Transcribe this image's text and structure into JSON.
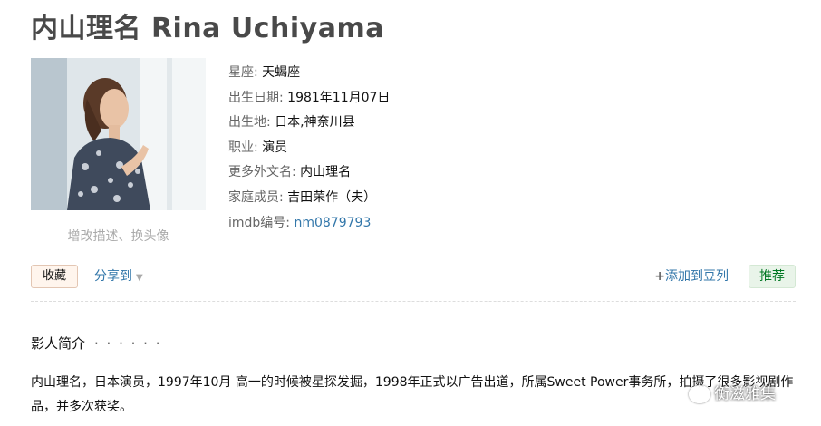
{
  "title": "内山理名 Rina Uchiyama",
  "photo": {
    "link_text": "增改描述、换头像"
  },
  "info": [
    {
      "label": "星座:",
      "value": "天蝎座"
    },
    {
      "label": "出生日期:",
      "value": "1981年11月07日"
    },
    {
      "label": "出生地:",
      "value": "日本,神奈川县"
    },
    {
      "label": "职业:",
      "value": "演员"
    },
    {
      "label": "更多外文名:",
      "value": "内山理名"
    },
    {
      "label": "家庭成员:",
      "value": "吉田荣作（夫）"
    },
    {
      "label": "imdb编号:",
      "value": "nm0879793"
    }
  ],
  "actions": {
    "fav": "收藏",
    "share": "分享到",
    "add_plus": "+",
    "add": "添加到豆列",
    "recommend": "推荐"
  },
  "intro": {
    "heading": "影人简介",
    "dots": "· · · · · ·",
    "text": "内山理名，日本演员，1997年10月 高一的时候被星探发掘，1998年正式以广告出道，所属Sweet Power事务所，拍摄了很多影视剧作品，并多次获奖。"
  },
  "watermark": "衡滋雅集",
  "colors": {
    "link": "#3377aa",
    "title": "#494949",
    "recommend_green": "#007722"
  }
}
